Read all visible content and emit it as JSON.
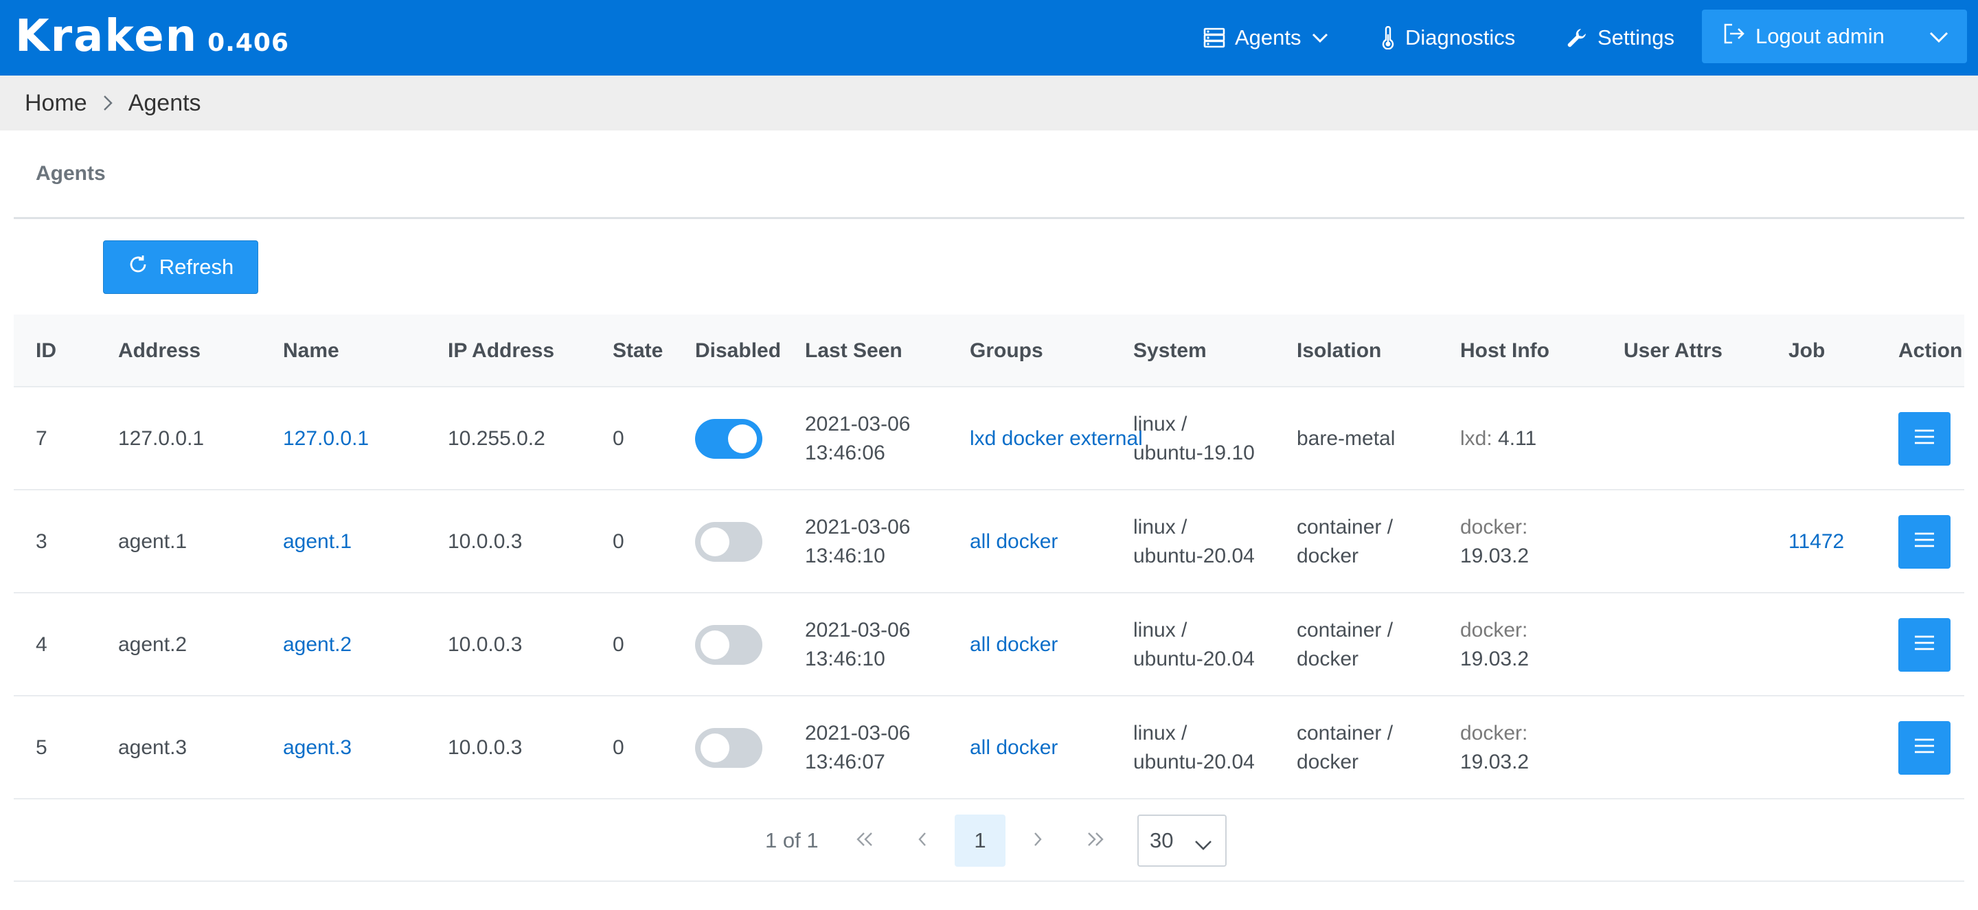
{
  "app": {
    "brand": "Kraken",
    "version": "0.406"
  },
  "nav": {
    "agents": "Agents",
    "diagnostics": "Diagnostics",
    "settings": "Settings",
    "logout": "Logout admin"
  },
  "breadcrumb": {
    "home": "Home",
    "current": "Agents"
  },
  "panel": {
    "title": "Agents",
    "refresh": "Refresh"
  },
  "table": {
    "headers": {
      "id": "ID",
      "address": "Address",
      "name": "Name",
      "ip": "IP Address",
      "state": "State",
      "disabled": "Disabled",
      "last_seen": "Last Seen",
      "groups": "Groups",
      "system": "System",
      "isolation": "Isolation",
      "host_info": "Host Info",
      "user_attrs": "User Attrs",
      "job": "Job",
      "action": "Action"
    },
    "rows": [
      {
        "id": "7",
        "address": "127.0.0.1",
        "name": "127.0.0.1",
        "ip": "10.255.0.2",
        "state": "0",
        "disabled": true,
        "seen_date": "2021-03-06",
        "seen_time": "13:46:06",
        "groups": "lxd docker external",
        "sys_os": "linux /",
        "sys_dist": "ubuntu-19.10",
        "iso_a": "bare-metal",
        "iso_b": "",
        "host_key": "lxd:",
        "host_val": "4.11",
        "attrs": "",
        "job": ""
      },
      {
        "id": "3",
        "address": "agent.1",
        "name": "agent.1",
        "ip": "10.0.0.3",
        "state": "0",
        "disabled": false,
        "seen_date": "2021-03-06",
        "seen_time": "13:46:10",
        "groups": "all docker",
        "sys_os": "linux /",
        "sys_dist": "ubuntu-20.04",
        "iso_a": "container /",
        "iso_b": "docker",
        "host_key": "docker:",
        "host_val": "19.03.2",
        "attrs": "",
        "job": "11472"
      },
      {
        "id": "4",
        "address": "agent.2",
        "name": "agent.2",
        "ip": "10.0.0.3",
        "state": "0",
        "disabled": false,
        "seen_date": "2021-03-06",
        "seen_time": "13:46:10",
        "groups": "all docker",
        "sys_os": "linux /",
        "sys_dist": "ubuntu-20.04",
        "iso_a": "container /",
        "iso_b": "docker",
        "host_key": "docker:",
        "host_val": "19.03.2",
        "attrs": "",
        "job": ""
      },
      {
        "id": "5",
        "address": "agent.3",
        "name": "agent.3",
        "ip": "10.0.0.3",
        "state": "0",
        "disabled": false,
        "seen_date": "2021-03-06",
        "seen_time": "13:46:07",
        "groups": "all docker",
        "sys_os": "linux /",
        "sys_dist": "ubuntu-20.04",
        "iso_a": "container /",
        "iso_b": "docker",
        "host_key": "docker:",
        "host_val": "19.03.2",
        "attrs": "",
        "job": ""
      }
    ]
  },
  "pagination": {
    "report": "1 of 1",
    "current_page": "1",
    "rows_per_page": "30"
  },
  "colors": {
    "topbar": "#0274d9",
    "primary": "#2196f3",
    "link": "#0a6ec9",
    "crumb_bg": "#eeeeee"
  },
  "icons": [
    "server-icon",
    "chevron-down-icon",
    "thermometer-icon",
    "wrench-icon",
    "sign-out-icon",
    "chevron-right-icon",
    "refresh-icon",
    "bars-icon",
    "double-left-icon",
    "left-icon",
    "right-icon",
    "double-right-icon"
  ]
}
